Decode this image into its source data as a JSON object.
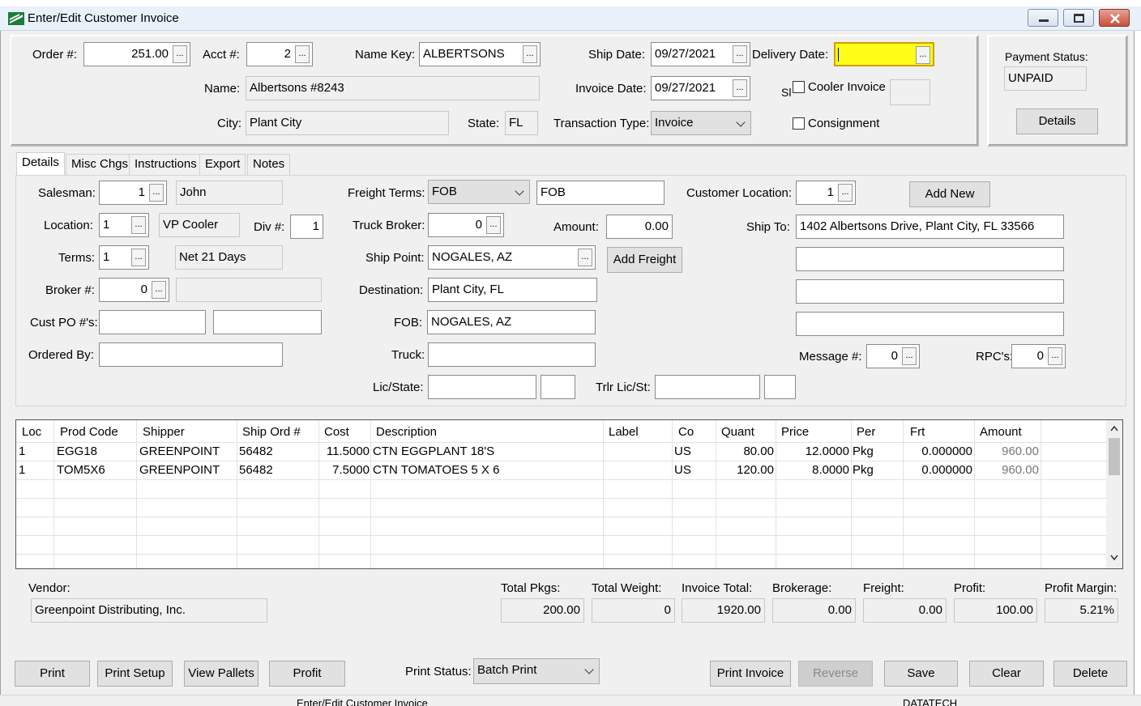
{
  "window": {
    "title": "Enter/Edit Customer Invoice"
  },
  "header": {
    "order_label": "Order #:",
    "order_value": "251.00",
    "acct_label": "Acct #:",
    "acct_value": "2",
    "namekey_label": "Name Key:",
    "namekey_value": "ALBERTSONS",
    "shipdate_label": "Ship Date:",
    "shipdate_value": "09/27/2021",
    "deliverydate_label": "Delivery Date:",
    "deliverydate_value": "",
    "name_label": "Name:",
    "name_value": "Albertsons #8243",
    "invoicedate_label": "Invoice Date:",
    "invoicedate_value": "09/27/2021",
    "hidden_fragment": "Sl",
    "cooler_invoice_label": "Cooler Invoice",
    "city_label": "City:",
    "city_value": "Plant City",
    "state_label": "State:",
    "state_value": "FL",
    "transtype_label": "Transaction Type:",
    "transtype_value": "Invoice",
    "consignment_label": "Consignment",
    "payment_status_label": "Payment Status:",
    "payment_status_value": "UNPAID",
    "details_button": "Details"
  },
  "tabs": [
    "Details",
    "Misc Chgs",
    "Instructions",
    "Export",
    "Notes"
  ],
  "details": {
    "salesman_label": "Salesman:",
    "salesman_value": "1",
    "salesman_name": "John",
    "location_label": "Location:",
    "location_value": "1",
    "location_name": "VP Cooler",
    "div_label": "Div #:",
    "div_value": "1",
    "terms_label": "Terms:",
    "terms_value": "1",
    "terms_name": "Net 21 Days",
    "broker_label": "Broker #:",
    "broker_value": "0",
    "custpo_label": "Cust PO #'s:",
    "orderedby_label": "Ordered By:",
    "freightterms_label": "Freight Terms:",
    "freightterms_value": "FOB",
    "freightterms_text": "FOB",
    "truckbroker_label": "Truck Broker:",
    "truckbroker_value": "0",
    "amount_label": "Amount:",
    "amount_value": "0.00",
    "shippoint_label": "Ship Point:",
    "shippoint_value": "NOGALES, AZ",
    "addfreight_button": "Add Freight",
    "destination_label": "Destination:",
    "destination_value": "Plant City, FL",
    "fob_label": "FOB:",
    "fob_value": "NOGALES, AZ",
    "truck_label": "Truck:",
    "licstate_label": "Lic/State:",
    "trlrlic_label": "Trlr Lic/St:",
    "custloc_label": "Customer Location:",
    "custloc_value": "1",
    "addnew_button": "Add New",
    "shipto_label": "Ship To:",
    "shipto_line1": "1402 Albertsons Drive, Plant City, FL 33566",
    "message_label": "Message #:",
    "message_value": "0",
    "rpc_label": "RPC's:",
    "rpc_value": "0"
  },
  "grid": {
    "columns": [
      "Loc",
      "Prod Code",
      "Shipper",
      "Ship Ord #",
      "Cost",
      "Description",
      "Label",
      "Co",
      "Quant",
      "Price",
      "Per",
      "Frt",
      "Amount"
    ],
    "rows": [
      [
        "1",
        "EGG18",
        "GREENPOINT",
        "56482",
        "11.5000",
        "CTN EGGPLANT 18'S",
        "",
        "US",
        "80.00",
        "12.0000",
        "Pkg",
        "0.000000",
        "960.00"
      ],
      [
        "1",
        "TOM5X6",
        "GREENPOINT",
        "56482",
        "7.5000",
        "CTN TOMATOES 5 X 6",
        "",
        "US",
        "120.00",
        "8.0000",
        "Pkg",
        "0.000000",
        "960.00"
      ]
    ]
  },
  "footer": {
    "vendor_label": "Vendor:",
    "vendor_value": "Greenpoint Distributing, Inc.",
    "totalpkgs_label": "Total Pkgs:",
    "totalpkgs_value": "200.00",
    "totalweight_label": "Total Weight:",
    "totalweight_value": "0",
    "invoicetotal_label": "Invoice Total:",
    "invoicetotal_value": "1920.00",
    "brokerage_label": "Brokerage:",
    "brokerage_value": "0.00",
    "freight_label": "Freight:",
    "freight_value": "0.00",
    "profit_label": "Profit:",
    "profit_value": "100.00",
    "profitmargin_label": "Profit Margin:",
    "profitmargin_value": "5.21%"
  },
  "buttons": {
    "print": "Print",
    "print_setup": "Print Setup",
    "view_pallets": "View Pallets",
    "profit": "Profit",
    "print_status_label": "Print Status:",
    "print_status_value": "Batch Print",
    "print_invoice": "Print Invoice",
    "reverse": "Reverse",
    "save": "Save",
    "clear": "Clear",
    "delete": "Delete"
  },
  "statusbar": {
    "left_text": "Enter/Edit Customer Invoice",
    "right_text": "DATATECH"
  },
  "colors": {
    "required_field": "#ffff1a",
    "title_bar": "#e9f2fb"
  }
}
